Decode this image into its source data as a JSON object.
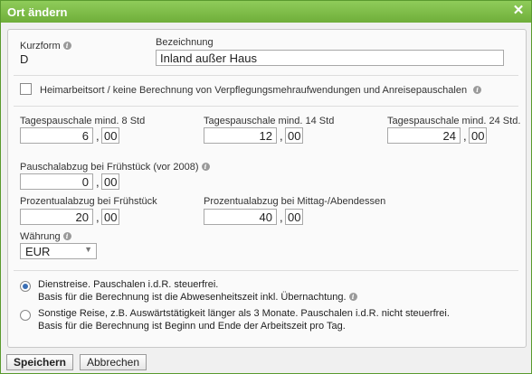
{
  "dialog": {
    "title": "Ort ändern",
    "close_symbol": "✕"
  },
  "kurzform": {
    "label": "Kurzform",
    "value": "D"
  },
  "bezeichnung": {
    "label": "Bezeichnung",
    "value": "Inland außer Haus"
  },
  "heimarbeitsort": {
    "label": "Heimarbeitsort / keine Berechnung von Verpflegungsmehraufwendungen und Anreisepauschalen",
    "checked": false
  },
  "tagespauschalen": [
    {
      "label": "Tagespauschale mind. 8 Std",
      "euro": "6",
      "cent": "00"
    },
    {
      "label": "Tagespauschale mind. 14 Std",
      "euro": "12",
      "cent": "00"
    },
    {
      "label": "Tagespauschale mind. 24 Std.",
      "euro": "24",
      "cent": "00"
    }
  ],
  "pauschalabzug": {
    "label": "Pauschalabzug bei Frühstück (vor 2008)",
    "euro": "0",
    "cent": "00"
  },
  "prozentualabzug_fruehstueck": {
    "label": "Prozentualabzug bei Frühstück",
    "euro": "20",
    "cent": "00"
  },
  "prozentualabzug_mittag": {
    "label": "Prozentualabzug bei Mittag-/Abendessen",
    "euro": "40",
    "cent": "00"
  },
  "waehrung": {
    "label": "Währung",
    "value": "EUR"
  },
  "comma": ",",
  "info_glyph": "i",
  "dropdown_glyph": "▼",
  "reiseart": [
    {
      "line1": "Dienstreise. Pauschalen i.d.R. steuerfrei.",
      "line2": "Basis für die Berechnung ist die Abwesenheitszeit inkl. Übernachtung.",
      "selected": true
    },
    {
      "line1": "Sonstige Reise, z.B. Auswärtstätigkeit länger als 3 Monate. Pauschalen i.d.R. nicht steuerfrei.",
      "line2": "Basis für die Berechnung ist Beginn und Ende der Arbeitszeit pro Tag.",
      "selected": false
    }
  ],
  "buttons": {
    "save": "Speichern",
    "cancel": "Abbrechen"
  },
  "colors": {
    "titlebar": "#7abd45",
    "radio_selected": "#3a6fb5"
  },
  "icons": {
    "info": "info-icon",
    "close": "close-icon"
  }
}
